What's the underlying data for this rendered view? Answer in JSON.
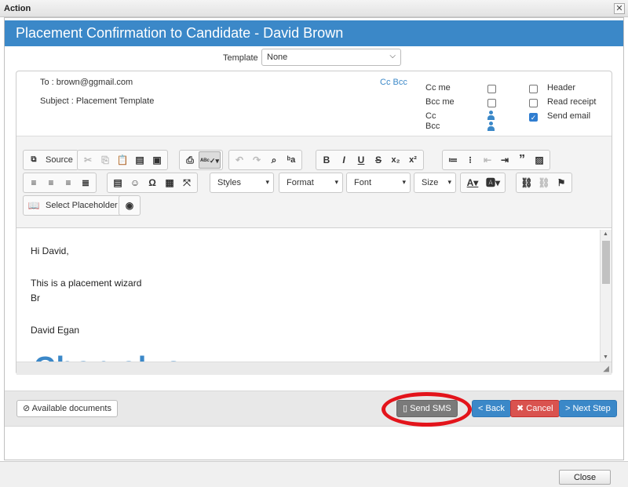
{
  "window": {
    "title": "Action",
    "close_glyph": "✕"
  },
  "dialog": {
    "heading": "Placement Confirmation to Candidate - David Brown"
  },
  "template": {
    "label": "Template",
    "value": "None"
  },
  "email": {
    "to_label": "To :",
    "to_value": "brown@ggmail.com",
    "subject_label": "Subject :",
    "subject_value": "Placement Template",
    "cc_bcc_link": "Cc Bcc",
    "options_left": [
      {
        "label": "Cc me",
        "checked": false
      },
      {
        "label": "Bcc me",
        "checked": false
      }
    ],
    "cc_label": "Cc",
    "bcc_label": "Bcc",
    "options_right": [
      {
        "label": "Header",
        "checked": false
      },
      {
        "label": "Read receipt",
        "checked": false
      },
      {
        "label": "Send email",
        "checked": true
      }
    ]
  },
  "toolbar": {
    "source_label": "Source",
    "styles": "Styles",
    "format": "Format",
    "font": "Font",
    "size": "Size",
    "select_placeholder": "Select Placeholder",
    "icons": [
      "source-icon",
      "cut-icon",
      "copy-icon",
      "paste-icon",
      "paste-text-icon",
      "paste-word-icon",
      "print-icon",
      "spellcheck-icon",
      "undo-icon",
      "redo-icon",
      "find-icon",
      "replace-icon",
      "bold-icon",
      "italic-icon",
      "underline-icon",
      "strike-icon",
      "subscript-icon",
      "superscript-icon",
      "numbered-list-icon",
      "bullet-list-icon",
      "outdent-icon",
      "indent-icon",
      "blockquote-icon",
      "image-icon",
      "align-left-icon",
      "align-center-icon",
      "align-right-icon",
      "justify-icon",
      "horizontal-rule-icon",
      "smiley-icon",
      "omega-icon",
      "table-icon",
      "maximize-icon",
      "text-color-icon",
      "bg-color-icon",
      "link-icon",
      "unlink-icon",
      "anchor-icon",
      "book-icon",
      "camera-icon"
    ]
  },
  "editor": {
    "lines": [
      "Hi David,",
      "This is a placement wizard",
      "Br",
      "David Egan"
    ],
    "logo_fragment": "Chan  ak  o"
  },
  "footer": {
    "available_docs": "Available documents",
    "send_sms": "Send SMS",
    "back": "< Back",
    "cancel": "✖ Cancel",
    "next": "> Next Step"
  },
  "bottom": {
    "close": "Close"
  },
  "colors": {
    "header": "#3b88c8",
    "highlight_ring": "#e3141b",
    "cancel": "#d9534f"
  }
}
